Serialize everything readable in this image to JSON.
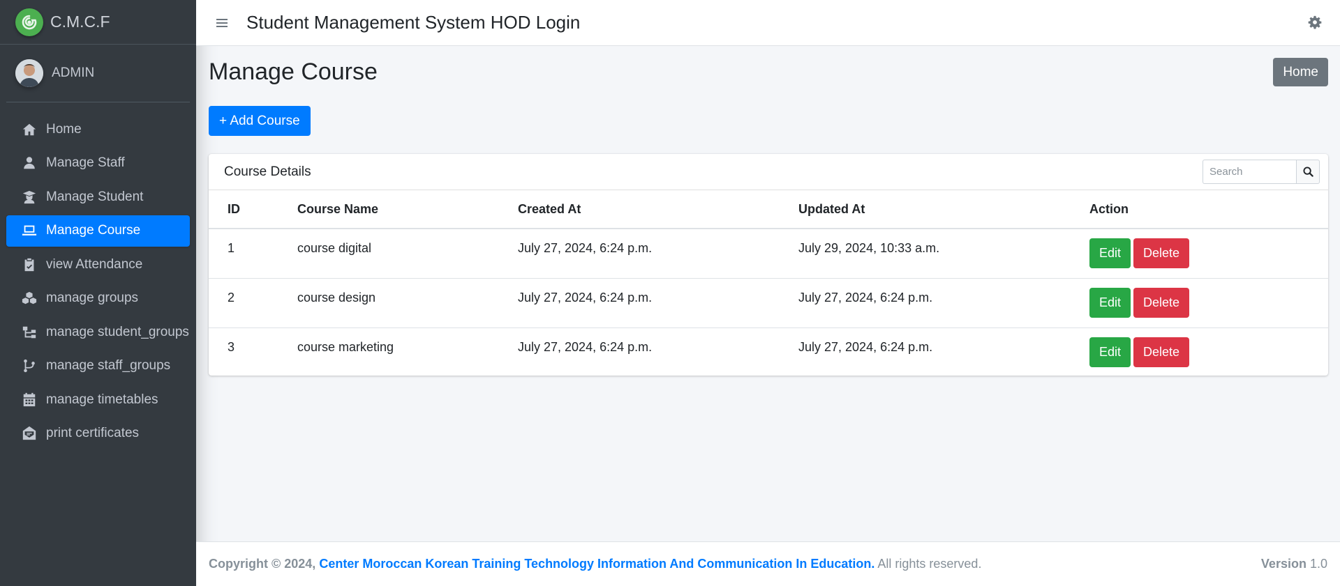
{
  "brand": {
    "name": "C.M.C.F"
  },
  "user": {
    "name": "ADMIN"
  },
  "sidebar": {
    "items": [
      {
        "label": "Home",
        "icon": "home-icon"
      },
      {
        "label": "Manage Staff",
        "icon": "user-icon"
      },
      {
        "label": "Manage Student",
        "icon": "user-graduate-icon"
      },
      {
        "label": "Manage Course",
        "icon": "laptop-icon",
        "active": true
      },
      {
        "label": "view Attendance",
        "icon": "clipboard-check-icon"
      },
      {
        "label": "manage groups",
        "icon": "cubes-icon"
      },
      {
        "label": "manage student_groups",
        "icon": "sitemap-icon"
      },
      {
        "label": "manage staff_groups",
        "icon": "code-branch-icon"
      },
      {
        "label": "manage timetables",
        "icon": "calendar-icon"
      },
      {
        "label": "print certificates",
        "icon": "envelope-open-icon"
      }
    ]
  },
  "header": {
    "title": "Student Management System HOD Login"
  },
  "main": {
    "page_title": "Manage Course",
    "home_button": "Home",
    "add_button": "+ Add Course"
  },
  "card": {
    "title": "Course Details",
    "search_placeholder": "Search"
  },
  "table": {
    "columns": [
      "ID",
      "Course Name",
      "Created At",
      "Updated At",
      "Action"
    ],
    "rows": [
      {
        "id": "1",
        "name": "course digital",
        "created": "July 27, 2024, 6:24 p.m.",
        "updated": "July 29, 2024, 10:33 a.m."
      },
      {
        "id": "2",
        "name": "course design",
        "created": "July 27, 2024, 6:24 p.m.",
        "updated": "July 27, 2024, 6:24 p.m."
      },
      {
        "id": "3",
        "name": "course marketing",
        "created": "July 27, 2024, 6:24 p.m.",
        "updated": "July 27, 2024, 6:24 p.m."
      }
    ],
    "edit_label": "Edit",
    "delete_label": "Delete"
  },
  "footer": {
    "copyright": "Copyright © 2024,",
    "org": "Center Moroccan Korean Training Technology Information And Communication In Education.",
    "rights": "All rights reserved.",
    "version_label": "Version",
    "version": "1.0"
  },
  "colors": {
    "sidebar_bg": "#343a40",
    "primary": "#007bff",
    "success": "#28a745",
    "danger": "#dc3545",
    "secondary": "#6c757d"
  }
}
